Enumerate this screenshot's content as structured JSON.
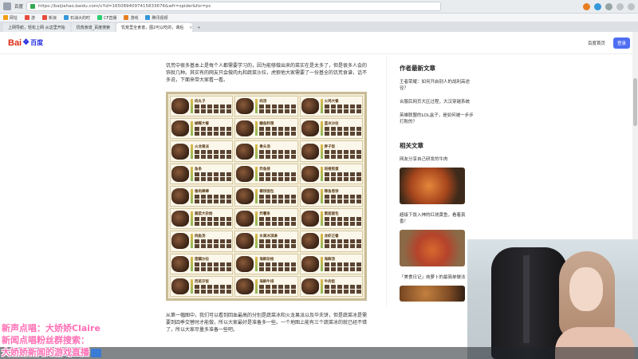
{
  "browser": {
    "url": "https://baijiahao.baidu.com/s?id=1650894097415833676&wfr=spider&for=pc",
    "browser_name": "百度",
    "bookmarks": [
      {
        "label": "网址",
        "color": "#f39c12"
      },
      {
        "label": "游",
        "color": "#e74c3c"
      },
      {
        "label": "新浪",
        "color": "#e74c3c"
      },
      {
        "label": "石油大的时",
        "color": "#3498db"
      },
      {
        "label": "CF直播",
        "color": "#2ecc71"
      },
      {
        "label": "游戏",
        "color": "#e67e22"
      },
      {
        "label": "腾讯视频",
        "color": "#3498db"
      }
    ],
    "tabs": [
      {
        "label": "上网导航，轻松上网 从这里开始",
        "active": false
      },
      {
        "label": "饥荒食谱_百度搜索",
        "active": false
      },
      {
        "label": "饥荒里全食谱，图2可以吃的，课后",
        "active": true
      }
    ],
    "new_tab": "+"
  },
  "header": {
    "logo_text": "Bai",
    "logo_paw": "❖",
    "logo_du": "du",
    "logo_cn": "百度",
    "home_link": "百度首页",
    "login_label": "登录"
  },
  "article": {
    "intro": "饥荒中很多基本上是每个人都需要学习的，因为能够做出来的菜实在是太多了，但是很多人会的饰就几种。其实有的网友只会做肉丸和蔬菜沙拉，虎狼他大家需要了一份基全的饥荒食谱，话不多说，下面来带大家看一看。",
    "grid_dishes": [
      "肉丸子",
      "肉汤",
      "火鸡大餐",
      "蝴蝶大餐",
      "鳗鱼料理",
      "蓝冰沙拉",
      "火龙果派",
      "骨头汤",
      "胖子饭",
      "鱼条",
      "炸鱼排",
      "培根煎蛋",
      "香肉棒棒",
      "椰饼面包",
      "辣鱼卷饼",
      "蔬菜大杂烩",
      "炸薯条",
      "素面面包",
      "炖鱼汤",
      "水果冰淇淋",
      "龙虾正餐",
      "莲藕沙拉",
      "海鲜杂烩",
      "海鲜汤",
      "西班牙饭",
      "海鲜牛排",
      "牛肉饭"
    ],
    "para2": "从第一幅图中，我们可以看到回血最高的分别是蔬菜冰和火龙果派以及华夫饼，但是蔬菜冰是需要到四季交替时才能做，所以大家最好是准备多一些。一个地图上能有三个蔬菜冰的就已经不错了，所以大家尽量多准备一些吧。"
  },
  "sidebar": {
    "author_title": "作者最新文章",
    "author_links": [
      "王者荣耀：如何开启别人的战利高途径？",
      "合服后网页大区过程，大汉穿越系统",
      "英雄联盟的LOL盒子，是如何被一步步打败的？"
    ],
    "related_title": "相关文章",
    "related": [
      {
        "caption": "网友分享自己研发的牛肉"
      },
      {
        "caption": "超级下饭入神的红烧黄鱼，看着真香！"
      },
      {
        "caption": "「美食日记」炖萝卜的最简单做法"
      }
    ]
  },
  "overlay": {
    "line1": "新声点唱：大娇娇Claire",
    "line2": "新闻点唱粉丝群搜索：",
    "line3": "大娇娇新闻的游戏直播"
  },
  "colors": {
    "accent": "#4e6ef2",
    "baidu_red": "#de2910",
    "baidu_blue": "#2932e1",
    "overlay_pink": "#ff6fb5"
  }
}
